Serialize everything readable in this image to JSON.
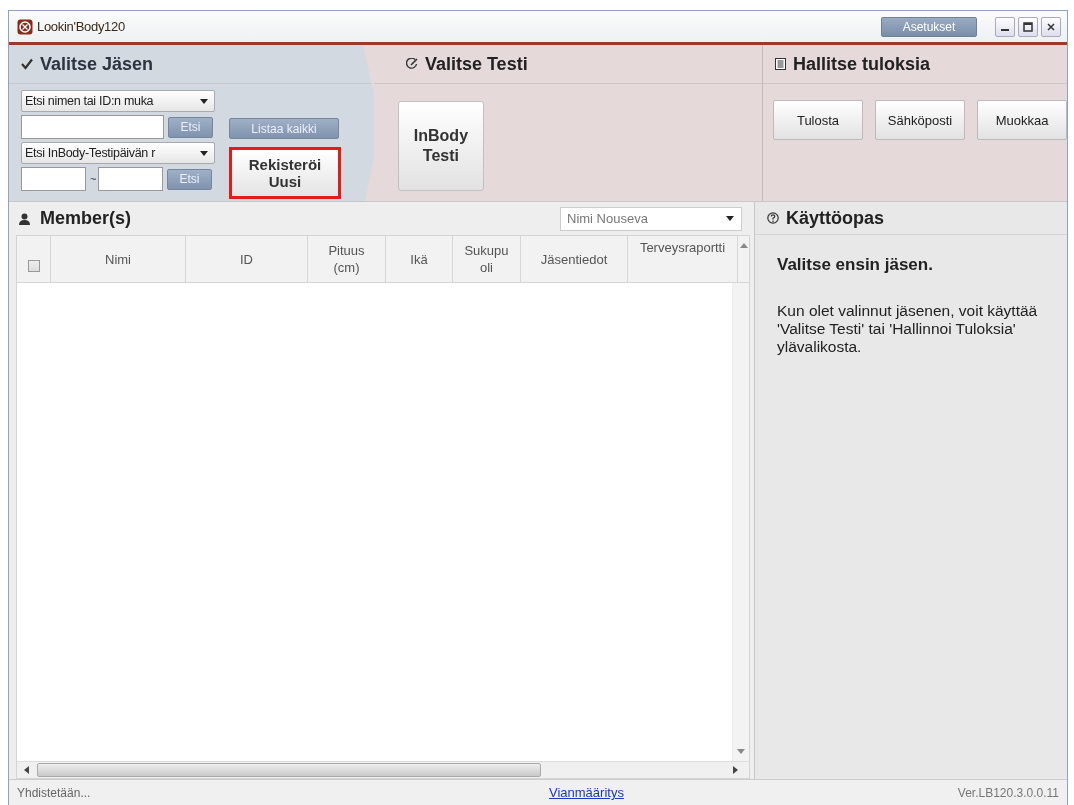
{
  "window": {
    "title": "Lookin'Body120",
    "settings_button": "Asetukset"
  },
  "select_member": {
    "title": "Valitse Jäsen",
    "search_mode": "Etsi nimen tai ID:n muka",
    "search_button": "Etsi",
    "list_all_button": "Listaa kaikki",
    "date_mode": "Etsi InBody-Testipäivän r",
    "range_separator": "~",
    "date_search_button": "Etsi",
    "register_button": {
      "label": "Rekisteröi Uusi",
      "highlighted": true
    }
  },
  "select_test": {
    "title": "Valitse Testi",
    "test_button": "InBody Testi"
  },
  "manage_results": {
    "title": "Hallitse tuloksia",
    "buttons": [
      "Tulosta",
      "Sähköposti",
      "Muokkaa"
    ]
  },
  "members": {
    "title": "Member(s)",
    "sort": "Nimi Nouseva",
    "select_all_checked": false,
    "columns": [
      {
        "label": "Nimi",
        "kind": "text"
      },
      {
        "label": "ID",
        "kind": "text"
      },
      {
        "label": "Pituus (cm)",
        "kind": "text"
      },
      {
        "label": "Ikä",
        "kind": "text"
      },
      {
        "label": "Sukupuoli",
        "kind": "split"
      },
      {
        "label": "Jäsentiedot",
        "kind": "text"
      },
      {
        "label": "Terveysraportti",
        "kind": "split"
      }
    ]
  },
  "guide": {
    "title": "Käyttöopas",
    "heading": "Valitse ensin jäsen.",
    "text": "Kun olet valinnut jäsenen, voit käyttää 'Valitse Testi' tai 'Hallinnoi Tuloksia' ylävalikosta."
  },
  "status_bar": {
    "status": "Yhdistetään...",
    "link": "Vianmääritys",
    "version": "Ver.LB120.3.0.0.11"
  }
}
